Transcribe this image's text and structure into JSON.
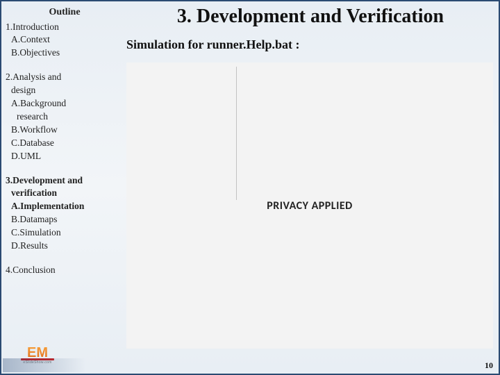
{
  "sidebar": {
    "header": "Outline",
    "items": [
      {
        "text": "1.Introduction",
        "cls": "lvl1"
      },
      {
        "text": "A.Context",
        "cls": "lvl2"
      },
      {
        "text": "B.Objectives",
        "cls": "lvl2"
      },
      {
        "text": "2.Analysis and",
        "cls": "lvl1 gap"
      },
      {
        "text": "design",
        "cls": "lvl2"
      },
      {
        "text": "A.Background",
        "cls": "lvl2"
      },
      {
        "text": "research",
        "cls": "lvl3"
      },
      {
        "text": "B.Workflow",
        "cls": "lvl2"
      },
      {
        "text": "C.Database",
        "cls": "lvl2"
      },
      {
        "text": "D.UML",
        "cls": "lvl2"
      },
      {
        "text": "3.Development and",
        "cls": "lvl1 gap bold"
      },
      {
        "text": "verification",
        "cls": "lvl2 bold"
      },
      {
        "text": "A.Implementation",
        "cls": "lvl2 bold"
      },
      {
        "text": "B.Datamaps",
        "cls": "lvl2"
      },
      {
        "text": "C.Simulation",
        "cls": "lvl2"
      },
      {
        "text": "D.Results",
        "cls": "lvl2"
      },
      {
        "text": "4.Conclusion",
        "cls": "lvl1 gap"
      }
    ]
  },
  "main": {
    "title": "3. Development and Verification",
    "subtitle": "Simulation for runner.Help.bat :",
    "privacy_label": "PRIVACY APPLIED"
  },
  "page_number": "10",
  "logo": {
    "text": "EM",
    "subtext": "eSlideShow.com"
  }
}
